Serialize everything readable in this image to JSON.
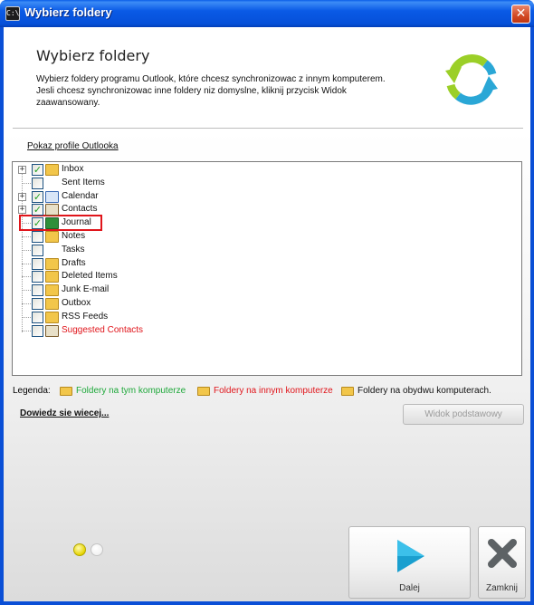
{
  "window": {
    "title": "Wybierz foldery",
    "app_icon_text": "C:\\",
    "close_glyph": "✕"
  },
  "header": {
    "title": "Wybierz foldery",
    "description": "Wybierz foldery programu Outlook, które chcesz synchronizowac z innym komputerem. Jesli chcesz synchronizowac inne foldery niz domyslne, kliknij przycisk Widok zaawansowany."
  },
  "profiles_link": "Pokaz profile Outlooka",
  "folders": [
    {
      "label": "Inbox",
      "checked": true,
      "expandable": true,
      "icon": "inbox-folder-icon",
      "color": "#111111"
    },
    {
      "label": "Sent Items",
      "checked": false,
      "expandable": false,
      "icon": "sent-items-icon",
      "color": "#111111"
    },
    {
      "label": "Calendar",
      "checked": true,
      "expandable": true,
      "icon": "calendar-icon",
      "color": "#111111"
    },
    {
      "label": "Contacts",
      "checked": true,
      "expandable": true,
      "icon": "contacts-icon",
      "color": "#111111"
    },
    {
      "label": "Journal",
      "checked": true,
      "expandable": false,
      "icon": "journal-icon",
      "color": "#111111"
    },
    {
      "label": "Notes",
      "checked": false,
      "expandable": false,
      "icon": "notes-folder-icon",
      "color": "#111111"
    },
    {
      "label": "Tasks",
      "checked": false,
      "expandable": false,
      "icon": "tasks-icon",
      "color": "#111111"
    },
    {
      "label": "Drafts",
      "checked": false,
      "expandable": false,
      "icon": "drafts-folder-icon",
      "color": "#111111"
    },
    {
      "label": "Deleted Items",
      "checked": false,
      "expandable": false,
      "icon": "deleted-items-folder-icon",
      "color": "#111111"
    },
    {
      "label": "Junk E-mail",
      "checked": false,
      "expandable": false,
      "icon": "junk-email-folder-icon",
      "color": "#111111"
    },
    {
      "label": "Outbox",
      "checked": false,
      "expandable": false,
      "icon": "outbox-folder-icon",
      "color": "#111111"
    },
    {
      "label": "RSS Feeds",
      "checked": false,
      "expandable": false,
      "icon": "rss-feeds-folder-icon",
      "color": "#111111"
    },
    {
      "label": "Suggested Contacts",
      "checked": false,
      "expandable": false,
      "icon": "suggested-contacts-icon",
      "color": "#e0151b"
    }
  ],
  "legend": {
    "label": "Legenda:",
    "items": [
      {
        "text": "Foldery na tym komputerze",
        "color": "#1ea83a"
      },
      {
        "text": "Foldery na innym komputerze",
        "color": "#e0151b"
      },
      {
        "text": "Foldery na obydwu komputerach.",
        "color": "#111111"
      }
    ]
  },
  "learn_more": "Dowiedz sie wiecej...",
  "basic_view_button": "Widok podstawowy",
  "wizard": {
    "step": 1,
    "total_steps": 2,
    "next_label": "Dalej",
    "close_label": "Zamknij"
  },
  "colors": {
    "titlebar": "#0a5ae6",
    "highlight": "#e0151b",
    "check": "#21a121",
    "next_arrow": "#1a9fcf"
  }
}
